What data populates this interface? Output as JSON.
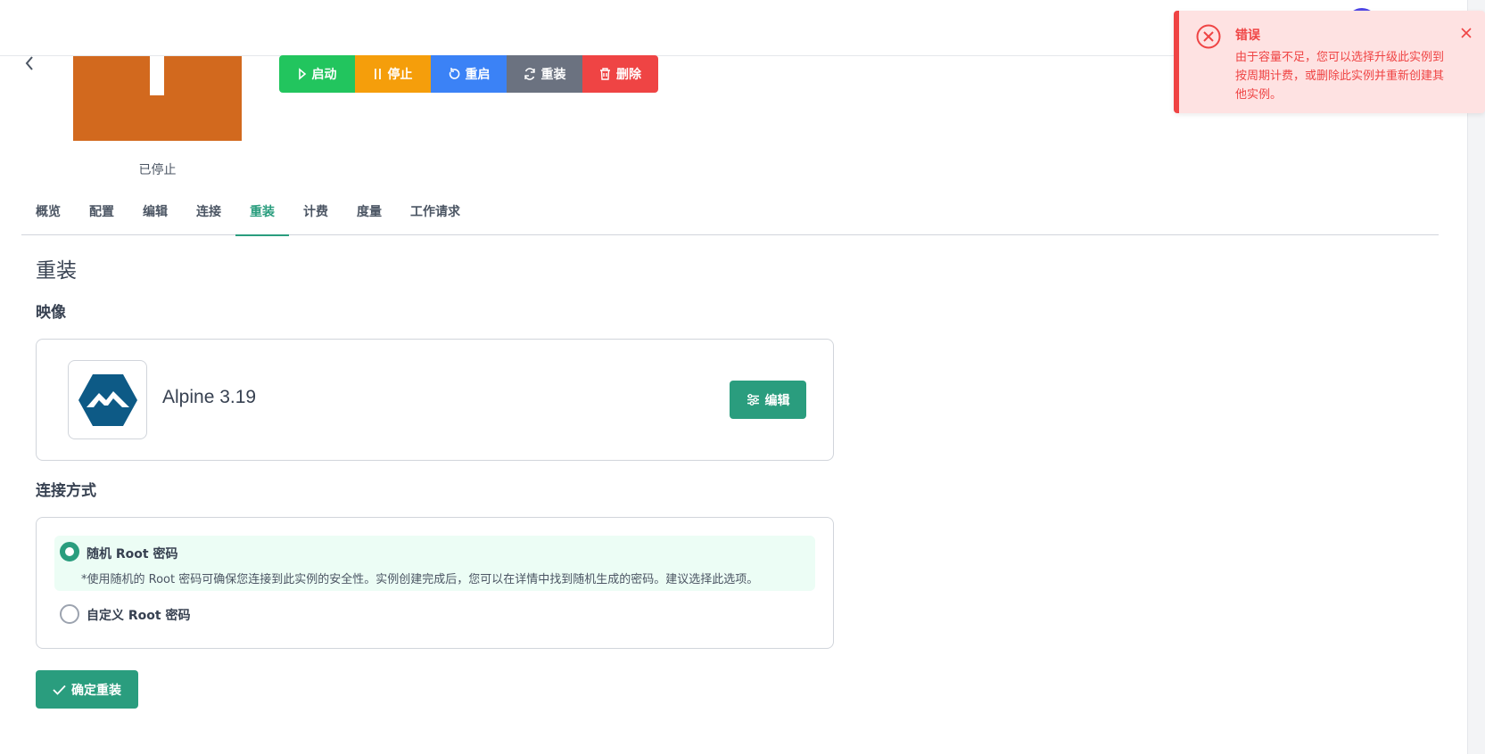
{
  "instance": {
    "status": "已停止"
  },
  "actions": {
    "start": "启动",
    "stop": "停止",
    "restart": "重启",
    "reinstall": "重装",
    "delete": "删除"
  },
  "tabs": [
    {
      "label": "概览"
    },
    {
      "label": "配置"
    },
    {
      "label": "编辑"
    },
    {
      "label": "连接"
    },
    {
      "label": "重装",
      "active": true
    },
    {
      "label": "计费"
    },
    {
      "label": "度量"
    },
    {
      "label": "工作请求"
    }
  ],
  "reinstall": {
    "title": "重装",
    "image_section": "映像",
    "image_name": "Alpine 3.19",
    "image_logo": "alpine-linux-logo",
    "edit_label": "编辑",
    "connection_section": "连接方式",
    "options": [
      {
        "label": "随机 Root 密码",
        "description": "*使用随机的 Root 密码可确保您连接到此实例的安全性。实例创建完成后，您可以在详情中找到随机生成的密码。建议选择此选项。",
        "selected": true
      },
      {
        "label": "自定义 Root 密码",
        "selected": false
      }
    ],
    "confirm_label": "确定重装"
  },
  "toast": {
    "title": "错误",
    "message": "由于容量不足，您可以选择升级此实例到按周期计费，或删除此实例并重新创建其他实例。"
  },
  "colors": {
    "primary": "#2a9d7e",
    "start": "#22c55e",
    "stop": "#f59e0b",
    "restart": "#3b82f6",
    "reinstall": "#6b7280",
    "delete": "#ef4444",
    "error": "#ef4444",
    "thumbnail": "#d2691e"
  }
}
